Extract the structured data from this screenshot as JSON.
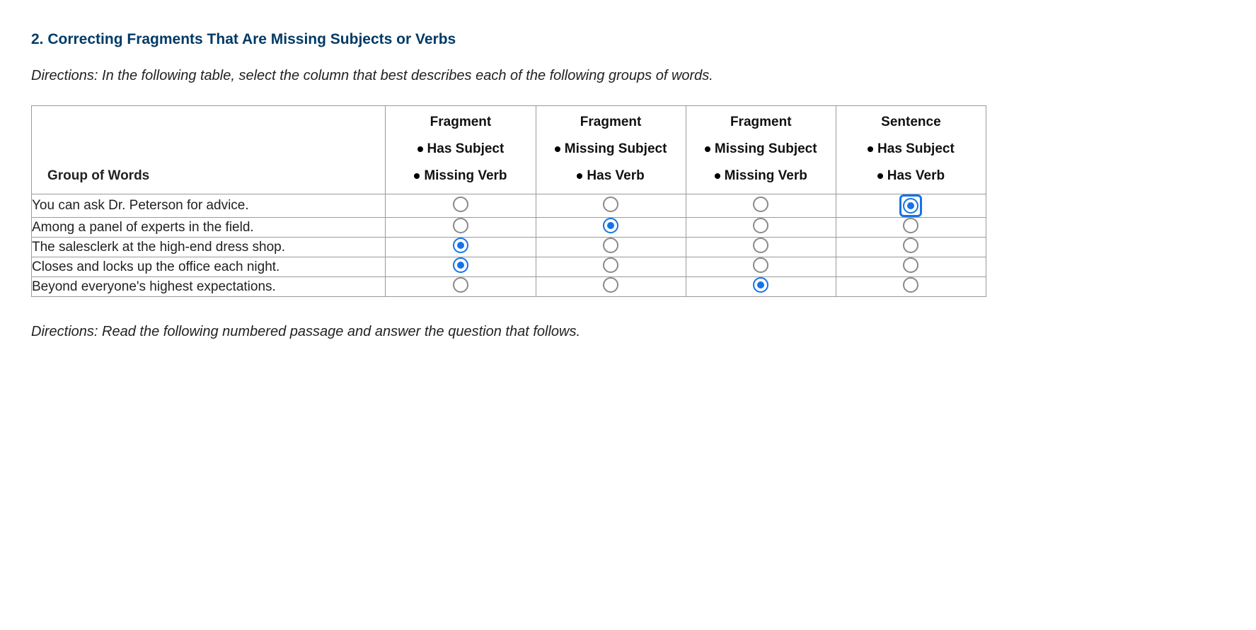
{
  "heading": "2. Correcting Fragments That Are Missing Subjects or Verbs",
  "directions_top": "Directions: In the following table, select the column that best describes each of the following groups of words.",
  "directions_bottom": "Directions: Read the following numbered passage and answer the question that follows.",
  "table": {
    "row_header": "Group of Words",
    "columns": [
      {
        "title": "Fragment",
        "line2": "Has Subject",
        "line3": "Missing Verb"
      },
      {
        "title": "Fragment",
        "line2": "Missing Subject",
        "line3": "Has Verb"
      },
      {
        "title": "Fragment",
        "line2": "Missing Subject",
        "line3": "Missing Verb"
      },
      {
        "title": "Sentence",
        "line2": "Has Subject",
        "line3": "Has Verb"
      }
    ],
    "rows": [
      {
        "text": "You can ask Dr. Peterson for advice.",
        "selected": 3,
        "focused": 3
      },
      {
        "text": "Among a panel of experts in the field.",
        "selected": 1,
        "focused": -1
      },
      {
        "text": "The salesclerk at the high-end dress shop.",
        "selected": 0,
        "focused": -1
      },
      {
        "text": "Closes and locks up the office each night.",
        "selected": 0,
        "focused": -1
      },
      {
        "text": "Beyond everyone's highest expectations.",
        "selected": 2,
        "focused": -1
      }
    ]
  }
}
